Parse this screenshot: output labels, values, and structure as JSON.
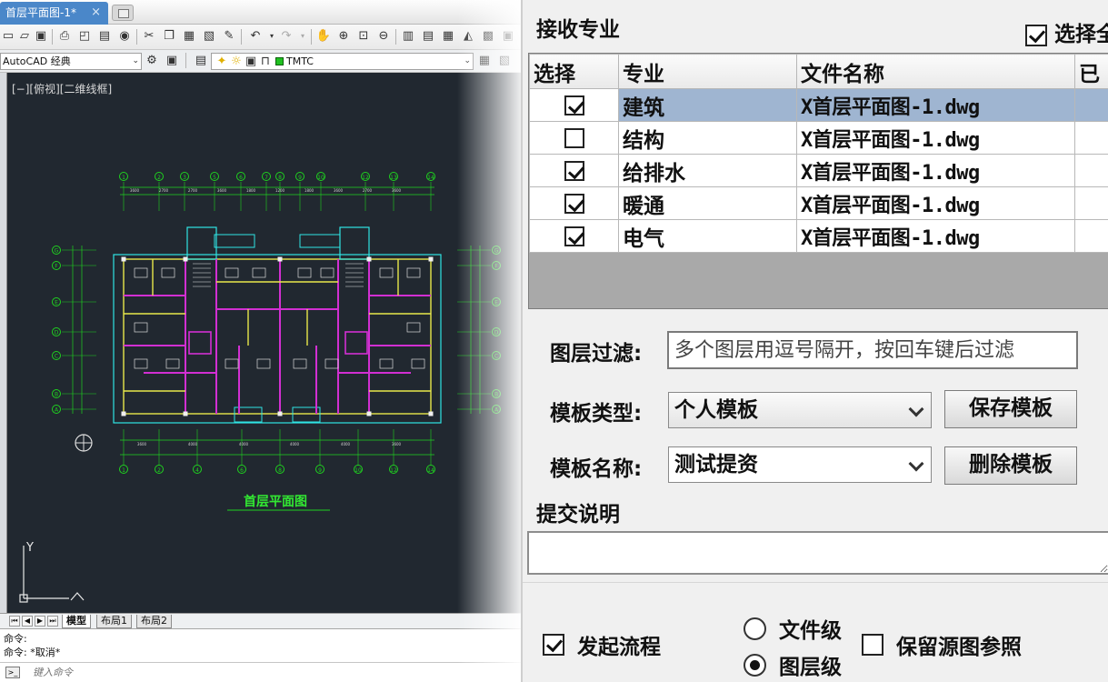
{
  "cad": {
    "doc_tab": "首层平面图-1*",
    "doc_tab_close": "×",
    "workspace": "AutoCAD 经典",
    "layer": "TMTC",
    "view_label": "[−][俯视][二维线框]",
    "plan_title": "首层平面图",
    "ucs_y": "Y",
    "layout_tabs": [
      "模型",
      "布局1",
      "布局2"
    ],
    "command_lines": [
      "命令:",
      "命令: *取消*"
    ],
    "command_placeholder": "键入命令",
    "axis_labels_top": [
      "1",
      "2",
      "3",
      "5",
      "6",
      "7",
      "8",
      "9",
      "10",
      "12",
      "13",
      "14"
    ],
    "axis_labels_bottom": [
      "1",
      "2",
      "4",
      "6",
      "8",
      "9",
      "10",
      "12",
      "14"
    ],
    "axis_labels_side": [
      "G",
      "F",
      "E",
      "D",
      "C",
      "B",
      "A"
    ],
    "top_dims": [
      "3600",
      "2700",
      "2700",
      "3600",
      "1800",
      "1200",
      "1800",
      "3600",
      "2700",
      "3600"
    ],
    "bottom_dims": [
      "3600",
      "4000",
      "4000",
      "4000",
      "4000",
      "3600"
    ],
    "colors": {
      "canvas": "#212830",
      "axis_lines": "#1fd21f",
      "walls": "#e8e84a",
      "partitions": "#d22fd2",
      "windows": "#2fe4e4",
      "tab_accent": "#4a87c9"
    }
  },
  "dialog": {
    "receive_title": "接收专业",
    "select_all": "选择全",
    "select_all_checked": true,
    "columns": [
      "选择",
      "专业",
      "文件名称",
      "已"
    ],
    "rows": [
      {
        "checked": true,
        "specialty": "建筑",
        "file": "X首层平面图-1.dwg",
        "selected": true
      },
      {
        "checked": false,
        "specialty": "结构",
        "file": "X首层平面图-1.dwg",
        "selected": false
      },
      {
        "checked": true,
        "specialty": "给排水",
        "file": "X首层平面图-1.dwg",
        "selected": false
      },
      {
        "checked": true,
        "specialty": "暖通",
        "file": "X首层平面图-1.dwg",
        "selected": false
      },
      {
        "checked": true,
        "specialty": "电气",
        "file": "X首层平面图-1.dwg",
        "selected": false
      }
    ],
    "layer_filter_label": "图层过滤:",
    "layer_filter_placeholder": "多个图层用逗号隔开，按回车键后过滤",
    "template_type_label": "模板类型:",
    "template_type_value": "个人模板",
    "save_template": "保存模板",
    "template_name_label": "模板名称:",
    "template_name_value": "测试提资",
    "delete_template": "删除模板",
    "submit_note_title": "提交说明",
    "start_flow": "发起流程",
    "start_flow_checked": true,
    "level_file": "文件级",
    "level_layer": "图层级",
    "level_selected": "图层级",
    "keep_source_ref": "保留源图参照",
    "keep_source_ref_checked": false,
    "selected_row_color": "#9fb5d1"
  }
}
